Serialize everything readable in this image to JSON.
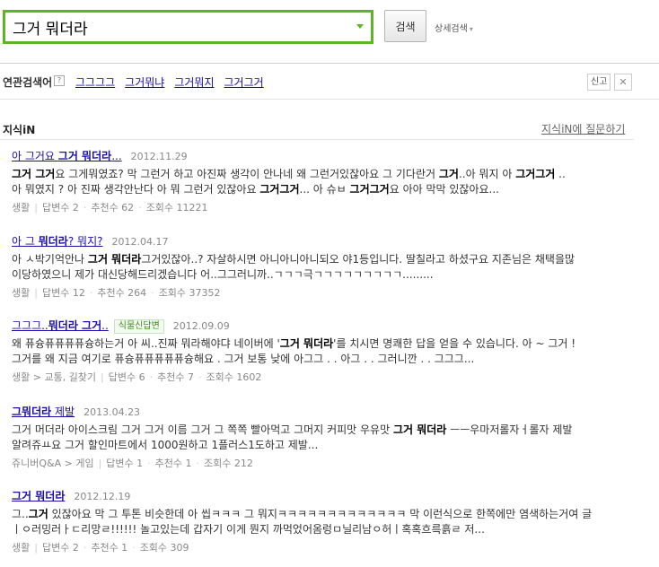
{
  "search": {
    "query": "그거 뭐더라",
    "button": "검색",
    "advanced": "상세검색"
  },
  "related": {
    "label": "연관검색어",
    "help": "?",
    "items": [
      "그그그그",
      "그거뭐냐",
      "그거뭐지",
      "그거그거"
    ],
    "report": "신고",
    "close": "✕"
  },
  "section": {
    "title": "지식iN",
    "ask_link": "지식iN에 질문하기"
  },
  "results": [
    {
      "title_pre": "아 그거요 ",
      "title_bold": "그거 뭐더라",
      "title_post": "...",
      "date": "2012.11.29",
      "line1": "<b>그거 그거</b>요 그게뭐였죠? 막 그런거 하고 아진짜 생각이 안나네 왜 그런거있잖아요 그 기다란거 <b>그거</b>..아 뭐지 아 <b>그거그거</b> ..",
      "line2": "아 뭐였지 ? 아 진짜 생각안난다 아 뭐 그런거 있잖아요 <b>그거그거</b>... 아 슈ㅂ <b>그거그거</b>요 아아 막막 있잖아요...",
      "category": "생활",
      "answers": "답변수 2",
      "recs": "추천수 62",
      "views": "조회수 11221"
    },
    {
      "title_pre": "아 그 ",
      "title_bold": "뭐더라",
      "title_post": "? 뭐지?",
      "date": "2012.04.17",
      "line1": "아 ㅅ박기억안나 <b>그거 뭐더라</b>그거있잖아..? 자살하시면 아니아니아니되오 야1등입니다. 딸칠라고 하셨구요 지존님은 채택을많",
      "line2": "이당하였으니 제가 대신당해드리겠습니다 어..그그러니까..ㄱㄱㄱ극ㄱㄱㄱㄱㄱㄱㄱㄱㄱ.........",
      "category": "생활",
      "answers": "답변수 12",
      "recs": "추천수 264",
      "views": "조회수 37352"
    },
    {
      "title_pre": "그그그..",
      "title_bold": "뭐더라 그거",
      "title_post": "..",
      "badge": "식물신답변",
      "date": "2012.09.09",
      "line1": "왜 퓨슝퓨퓨퓨퓨슝하는거 아 씨..진짜 뭐라해야댜 네이버에 '<b>그거 뭐더라</b>'를 치시면 명쾌한 답을 얻을 수 있습니다. 아 ~ 그거 !",
      "line2": "그거를 왜 지금 여기로 퓨슝퓨퓨퓨퓨퓨슝해요 . 그거 보통 낮에 아그그 . . 아그 . . 그러니깐 . . 그그그...",
      "category": "생활 > 교통, 길찾기",
      "answers": "답변수 6",
      "recs": "추천수 7",
      "views": "조회수 1602"
    },
    {
      "title_pre": "",
      "title_bold": "그뭐더라",
      "title_post": " 제발",
      "date": "2013.04.23",
      "line1": "그거 머더라 아이스크림 그거 그거 이름 그거 그 쪽쪽 빨아먹고 그머지 커피맛 우유맛 <b>그거 뭐더라</b> ㅡㅡ우마저롤자ㅓ롤자 제발",
      "line2": "알려쥬ㅛ요 그거 할인마트에서 1000원하고 1플러스1도하고 제발...",
      "category": "쥬니버Q&A > 게임",
      "answers": "답변수 1",
      "recs": "추천수 1",
      "views": "조회수 212"
    },
    {
      "title_pre": "",
      "title_bold": "그거 뭐더라",
      "title_post": "",
      "date": "2012.12.19",
      "line1": "그..<b>그거</b> 있잖아요 막 그 투톤 비슷한데 아 씹ㅋㅋㅋ 그 뭐지ㅋㅋㅋㅋㅋㅋㅋㅋㅋㅋㅋㅋㅋ 막 이런식으로 한쪽에만 염색하는거여 글",
      "line2": "ㅣㅇ러밍러ㅏㄷ리망ㄹ!!!!!! 놀고있는데 갑자기 이게 뭔지 까먹었어옴렁ㅁ닐리남ㅇ허ㅣ혹혹흐륵흙ㄹ 저...",
      "category": "생활",
      "answers": "답변수 2",
      "recs": "추천수 1",
      "views": "조회수 309"
    }
  ]
}
